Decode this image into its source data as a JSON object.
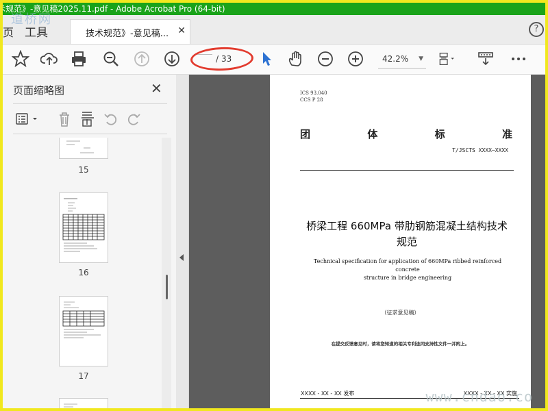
{
  "window": {
    "title": "术规范》-意见稿2025.11.pdf - Adobe Acrobat Pro (64-bit)"
  },
  "watermark": {
    "top_left": "道桥网",
    "bottom_right": "www.cndao.co"
  },
  "tabs": {
    "home_stub": "页",
    "tools": "工具",
    "document_tab": "技术规范》-意见稿...",
    "close_icon": "close-icon",
    "help": "?"
  },
  "toolbar": {
    "icons": [
      "star-icon",
      "upload-icon",
      "print-icon",
      "search-icon",
      "page-up-icon",
      "page-down-icon",
      "pointer-icon",
      "hand-icon",
      "zoom-out-icon",
      "zoom-in-icon",
      "scroll-mode-icon",
      "toolbar-tool-icon",
      "more-icon"
    ],
    "page_current": "",
    "page_separator": "/",
    "page_total": "33",
    "zoom": "42.2%",
    "highlight_color": "#e23b2e"
  },
  "left_panel": {
    "title": "页面缩略图",
    "thumbnails": [
      {
        "number": "15"
      },
      {
        "number": "16"
      },
      {
        "number": "17"
      }
    ]
  },
  "document": {
    "ics": "ICS  93.040",
    "ccs": "CCS  P  28",
    "standard_chars": [
      "团",
      "体",
      "标",
      "准"
    ],
    "standard_number": "T/JSCTS XXXX—XXXX",
    "title_cn_line1": "桥梁工程 660MPa 带肋钢筋混凝土结构技术",
    "title_cn_line2": "规范",
    "title_en_line1": "Technical specification for application of 660MPa ribbed reinforced concrete",
    "title_en_line2": "structure in bridge engineering",
    "draft_label": "（征求意见稿）",
    "submission_note": "在提交反馈意见时，请将您知道的相关专利连同支持性文件一并附上。",
    "issue_date": "XXXX - XX - XX 发布",
    "implementation_date": "XXXX - XX - XX 实施"
  },
  "colors": {
    "titlebar": "#1aa31a",
    "frame": "#f1e81e",
    "pointer_active": "#2d72d2"
  }
}
